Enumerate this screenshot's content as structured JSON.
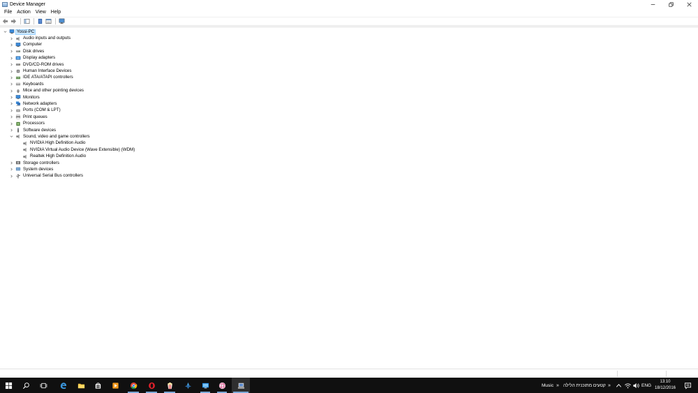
{
  "window": {
    "title": "Device Manager"
  },
  "menu": [
    "File",
    "Action",
    "View",
    "Help"
  ],
  "tree": {
    "root": "Yossi-PC",
    "categories": [
      {
        "label": "Audio inputs and outputs",
        "icon": "speaker-icon"
      },
      {
        "label": "Computer",
        "icon": "computer-icon"
      },
      {
        "label": "Disk drives",
        "icon": "disk-drive-icon"
      },
      {
        "label": "Display adapters",
        "icon": "display-adapter-icon"
      },
      {
        "label": "DVD/CD-ROM drives",
        "icon": "dvd-drive-icon"
      },
      {
        "label": "Human Interface Devices",
        "icon": "hid-icon"
      },
      {
        "label": "IDE ATA/ATAPI controllers",
        "icon": "ide-controller-icon"
      },
      {
        "label": "Keyboards",
        "icon": "keyboard-icon"
      },
      {
        "label": "Mice and other pointing devices",
        "icon": "mouse-icon"
      },
      {
        "label": "Monitors",
        "icon": "monitor-icon"
      },
      {
        "label": "Network adapters",
        "icon": "network-adapter-icon"
      },
      {
        "label": "Ports (COM & LPT)",
        "icon": "port-icon"
      },
      {
        "label": "Print queues",
        "icon": "printer-icon"
      },
      {
        "label": "Processors",
        "icon": "processor-icon"
      },
      {
        "label": "Software devices",
        "icon": "software-device-icon"
      },
      {
        "label": "Sound, video and game controllers",
        "icon": "speaker-icon",
        "expanded": true,
        "children": [
          "NVIDIA High Definition Audio",
          "NVIDIA Virtual Audio Device (Wave Extensible) (WDM)",
          "Realtek High Definition Audio"
        ]
      },
      {
        "label": "Storage controllers",
        "icon": "storage-controller-icon"
      },
      {
        "label": "System devices",
        "icon": "system-device-icon"
      },
      {
        "label": "Universal Serial Bus controllers",
        "icon": "usb-icon"
      }
    ]
  },
  "taskbar": {
    "tray_music": "Music",
    "tray_hebrew": "קטעים מתוכנית הלילה",
    "language": "ENG",
    "time": "13:10",
    "date": "18/12/2016"
  },
  "colors": {
    "selection": "#cce8ff",
    "taskbar": "#101010",
    "accent": "#7aa8d6"
  }
}
